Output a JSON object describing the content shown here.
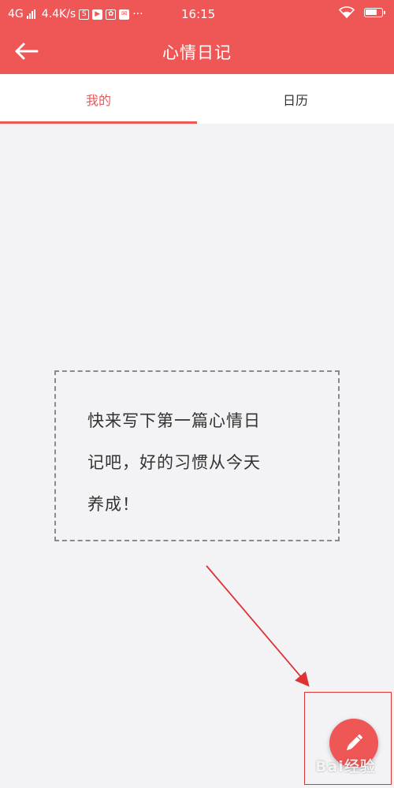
{
  "status_bar": {
    "network": "4G",
    "speed": "4.4K/s",
    "more": "···",
    "time": "16:15"
  },
  "app_bar": {
    "title": "心情日记"
  },
  "tabs": [
    {
      "label": "我的",
      "active": true
    },
    {
      "label": "日历",
      "active": false
    }
  ],
  "empty_state": {
    "lines": [
      "快来写下第一篇心情日",
      "记吧，好的习惯从今天",
      "养成！"
    ]
  },
  "fab": {
    "icon": "pencil-icon"
  },
  "watermark": "Bai经验",
  "colors": {
    "primary": "#ef5756",
    "background": "#f3f3f5",
    "annotation": "#d33"
  }
}
